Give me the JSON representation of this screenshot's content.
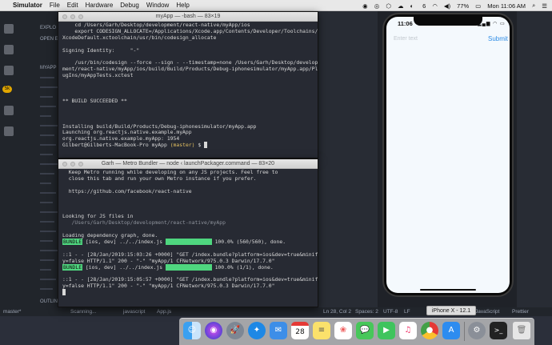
{
  "menubar": {
    "apple": "",
    "app_name": "Simulator",
    "items": [
      "File",
      "Edit",
      "Hardware",
      "Debug",
      "Window",
      "Help"
    ],
    "status_right": {
      "badge": "6",
      "battery": "77%",
      "clock": "Mon 11:06 AM"
    }
  },
  "editor": {
    "sidebar_labels": [
      "EXPLO",
      "OPEN E",
      "MYAPP"
    ],
    "bottom_label": "OUTLIN",
    "badge": "5k",
    "statusbar": {
      "branch": "master*",
      "scanning": "Scanning...",
      "lang_hint": "javascript",
      "file": "App.js",
      "position": "Ln 28, Col 2",
      "spaces": "Spaces: 2",
      "encoding": "UTF-8",
      "eol": "LF",
      "language": "JavaScript",
      "formatter": "Prettier"
    }
  },
  "terminal1": {
    "title": "myApp — -bash — 83×19",
    "lines": [
      "    cd /Users/Garh/Desktop/development/react-native/myApp/ios",
      "    export CODESIGN_ALLOCATE=/Applications/Xcode.app/Contents/Developer/Toolchains/",
      "XcodeDefault.xctoolchain/usr/bin/codesign_allocate",
      "",
      "Signing Identity:     \"-\"",
      "",
      "    /usr/bin/codesign --force --sign - --timestamp=none /Users/Garh/Desktop/develop",
      "ment/react-native/myApp/ios/build/Build/Products/Debug-iphonesimulator/myApp.app/Pl",
      "ugIns/myAppTests.xctest",
      "",
      "",
      "",
      "** BUILD SUCCEEDED **",
      "",
      "",
      "",
      "Installing build/Build/Products/Debug-iphonesimulator/myApp.app",
      "Launching org.reactjs.native.example.myApp",
      "org.reactjs.native.example.myApp: 1954"
    ],
    "prompt_user": "Gilbert@Gilberts-MacBook-Pro",
    "prompt_dir": "myApp",
    "prompt_branch": "(master)",
    "prompt_symbol": "$"
  },
  "terminal2": {
    "title": "Garh — Metro Bundler — node ‹ launchPackager.command — 83×20",
    "lines": [
      "  Keep Metro running while developing on any JS projects. Feel free to",
      "  close this tab and run your own Metro instance if you prefer.",
      "",
      "  https://github.com/facebook/react-native",
      "",
      "",
      "",
      "Looking for JS files in",
      "   /Users/Garh/Desktop/development/react-native/myApp",
      "",
      "Loading dependency graph, done."
    ],
    "bundle_tag": "BUNDLE",
    "bundle1_text": " [ios, dev] ../../index.js ",
    "bundle1_progress": "100.0% (560/560), done.",
    "log1a": "::1 - - [28/Jan/2019:15:03:26 +0000] \"GET /index.bundle?platform=ios&dev=true&minif",
    "log1b": "y=false HTTP/1.1\" 200 - \"-\" \"myApp/1 CFNetwork/975.0.3 Darwin/17.7.0\"",
    "bundle2_text": " [ios, dev] ../../index.js ",
    "bundle2_progress": "100.0% (1/1), done.",
    "log2a": "::1 - - [28/Jan/2019:15:05:57 +0000] \"GET /index.bundle?platform=ios&dev=true&minif",
    "log2b": "y=false HTTP/1.1\" 200 - \"-\" \"myApp/1 CFNetwork/975.0.3 Darwin/17.7.0\""
  },
  "simulator": {
    "device_label": "iPhone X - 12.1",
    "time": "11:06",
    "status_icons": "▂▄▆ ◠ ▭",
    "input_placeholder": "Enter text",
    "submit_label": "Submit"
  },
  "dock": {
    "calendar_day": "28"
  }
}
